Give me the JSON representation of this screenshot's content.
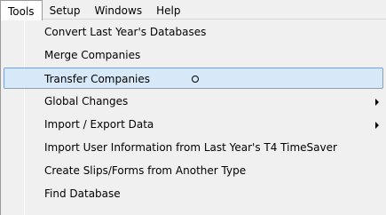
{
  "menubar": {
    "items": [
      {
        "label": "Tools"
      },
      {
        "label": "Setup"
      },
      {
        "label": "Windows"
      },
      {
        "label": "Help"
      }
    ]
  },
  "dropdown": {
    "items": [
      {
        "label": "Convert Last Year's Databases",
        "has_submenu": false
      },
      {
        "label": "Merge Companies",
        "has_submenu": false
      },
      {
        "label": "Transfer Companies",
        "has_submenu": false,
        "highlighted": true
      },
      {
        "label": "Global Changes",
        "has_submenu": true
      },
      {
        "label": "Import / Export Data",
        "has_submenu": true
      },
      {
        "label": "Import User Information from Last Year's T4 TimeSaver",
        "has_submenu": false
      },
      {
        "label": "Create Slips/Forms from Another Type",
        "has_submenu": false
      },
      {
        "label": "Find Database",
        "has_submenu": false
      }
    ]
  },
  "colors": {
    "highlight_bg": "#d7e8f8",
    "highlight_border": "#7da2ce",
    "menu_bg": "#f0f0f0"
  }
}
